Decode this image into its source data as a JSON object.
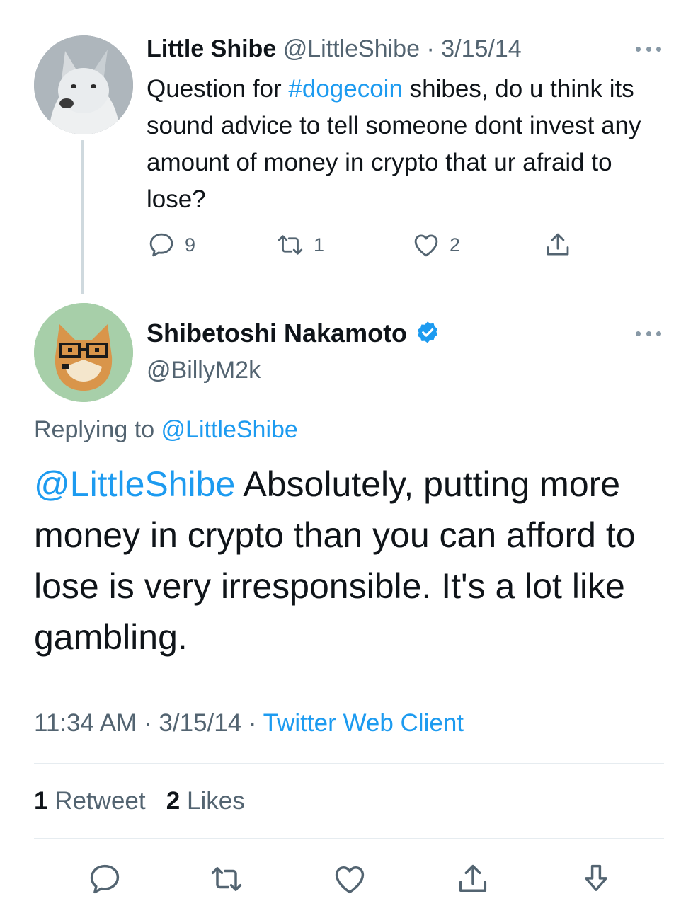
{
  "parent_tweet": {
    "name": "Little Shibe",
    "handle": "@LittleShibe",
    "separator": "·",
    "date": "3/15/14",
    "text_before": "Question for ",
    "hashtag": "#dogecoin",
    "text_after": " shibes, do u think its sound advice to tell someone dont invest any amount of money in crypto that ur afraid to lose?",
    "replies": "9",
    "retweets": "1",
    "likes": "2"
  },
  "reply_tweet": {
    "name": "Shibetoshi Nakamoto",
    "verified": true,
    "handle": "@BillyM2k",
    "replying_label": "Replying to ",
    "replying_to": "@LittleShibe",
    "mention": "@LittleShibe",
    "text": " Absolutely, putting more money in crypto than you can afford to lose is very irresponsible. It's a lot like gambling.",
    "time": "11:34 AM",
    "date": "3/15/14",
    "source": "Twitter Web Client",
    "dot": "·"
  },
  "stats": {
    "retweet_count": "1",
    "retweet_label": "Retweet",
    "like_count": "2",
    "like_label": "Likes"
  },
  "colors": {
    "accent": "#1d9bf0",
    "muted": "#536471",
    "text": "#0f1419",
    "divider": "#e6ecf0"
  },
  "icons": [
    "reply-icon",
    "retweet-icon",
    "like-icon",
    "share-icon",
    "more-icon",
    "verified-badge-icon",
    "bookmark-icon"
  ]
}
